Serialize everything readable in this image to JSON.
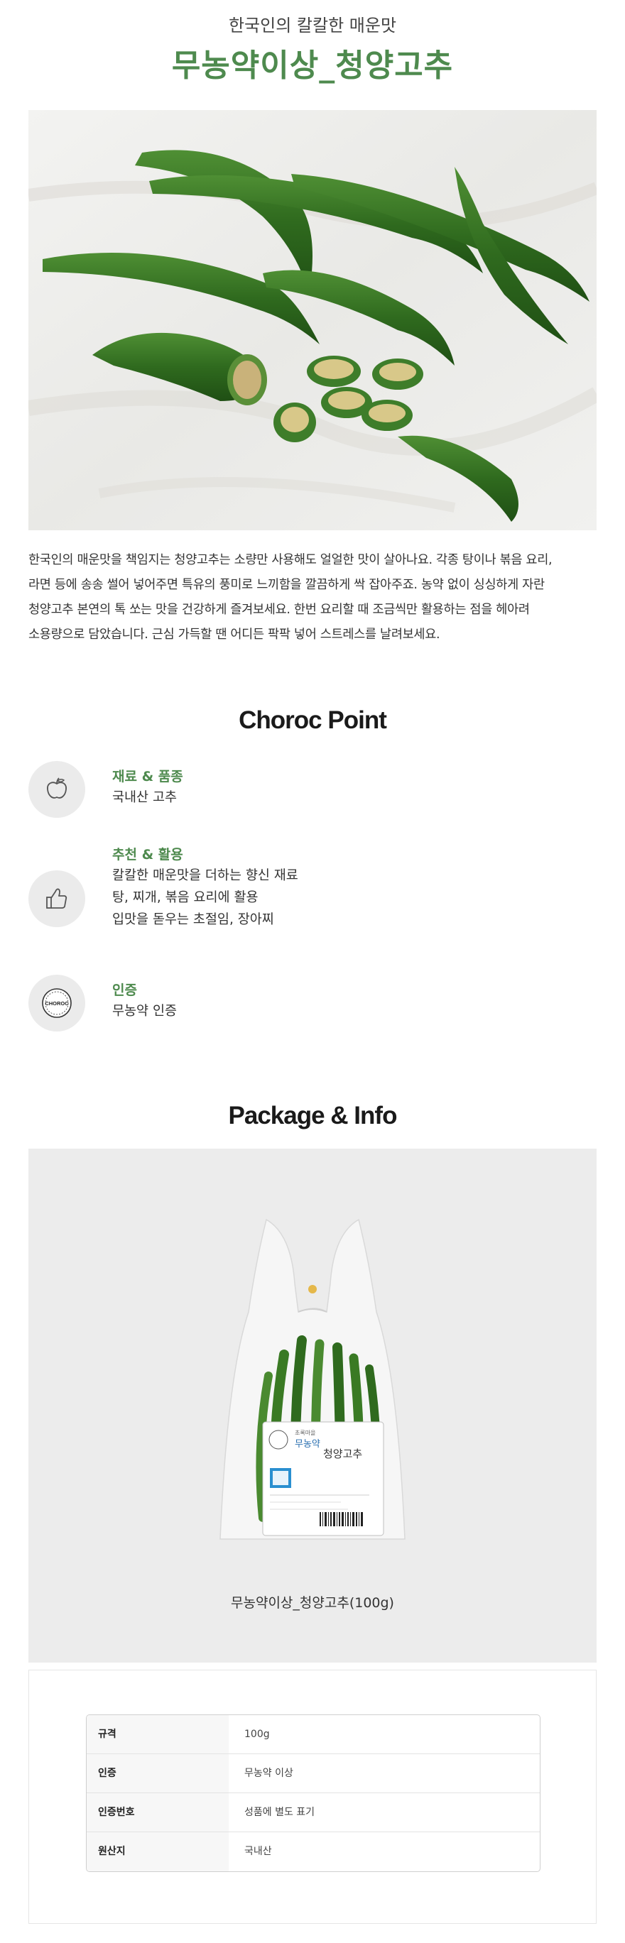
{
  "header": {
    "subtitle": "한국인의 칼칼한 매운맛",
    "title": "무농약이상_청양고추"
  },
  "hero_image": {
    "subject": "green-chili-peppers-on-linen"
  },
  "description": [
    "한국인의 매운맛을 책임지는 청양고추는 소량만 사용해도 얼얼한 맛이 살아나요. 각종 탕이나 볶음 요리,",
    "라면 등에 송송 썰어 넣어주면 특유의 풍미로 느끼함을 깔끔하게 싹 잡아주죠. 농약 없이 싱싱하게 자란",
    "청양고추 본연의 톡 쏘는 맛을 건강하게 즐겨보세요. 한번 요리할 때 조금씩만 활용하는 점을 헤아려",
    "소용량으로 담았습니다. 근심 가득할 땐 어디든 팍팍 넣어 스트레스를 날려보세요."
  ],
  "points": {
    "title": "Choroc Point",
    "items": [
      {
        "icon": "apple-icon",
        "label": "재료 & 품종",
        "lines": [
          "국내산 고추"
        ]
      },
      {
        "icon": "thumbs-up-icon",
        "label": "추천 & 활용",
        "lines": [
          "칼칼한 매운맛을 더하는 향신 재료",
          "탕, 찌개, 볶음 요리에 활용",
          "입맛을 돋우는 초절임, 장아찌"
        ]
      },
      {
        "icon": "choroc-badge-icon",
        "label": "인증",
        "lines": [
          "무농약 인증"
        ],
        "badge_text": "CHOROC"
      }
    ]
  },
  "package": {
    "title": "Package & Info",
    "caption": "무농약이상_청양고추(100g)",
    "label_brand": "초록마을",
    "label_cert": "무농약",
    "label_name": "청양고추"
  },
  "info_table": [
    {
      "key": "규격",
      "value": "100g"
    },
    {
      "key": "인증",
      "value": "무농약 이상"
    },
    {
      "key": "인증번호",
      "value": "성품에 별도 표기"
    },
    {
      "key": "원산지",
      "value": "국내산"
    }
  ],
  "colors": {
    "accent": "#4e8a4e",
    "icon_bg": "#ebebeb",
    "package_bg": "#ececec"
  }
}
